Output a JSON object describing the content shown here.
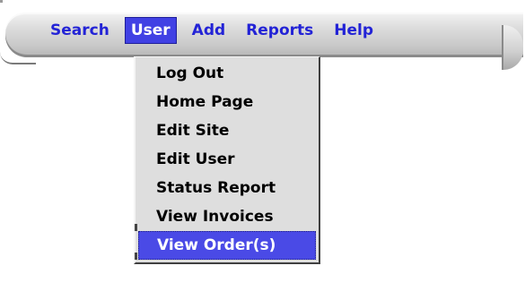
{
  "menubar": {
    "items": [
      {
        "label": "Search",
        "active": false
      },
      {
        "label": "User",
        "active": true
      },
      {
        "label": "Add",
        "active": false
      },
      {
        "label": "Reports",
        "active": false
      },
      {
        "label": "Help",
        "active": false
      }
    ]
  },
  "dropdown": {
    "items": [
      {
        "label": "Log Out"
      },
      {
        "label": "Home Page"
      },
      {
        "label": "Edit Site"
      },
      {
        "label": "Edit User"
      },
      {
        "label": "Status Report"
      },
      {
        "label": "View Invoices"
      },
      {
        "label": "View Order(s)",
        "highlighted": true
      }
    ]
  },
  "colors": {
    "menu_text": "#2323d6",
    "active_bg": "#4141e4",
    "dropdown_bg": "#dedede",
    "highlight_bg": "#4a4ae6"
  }
}
